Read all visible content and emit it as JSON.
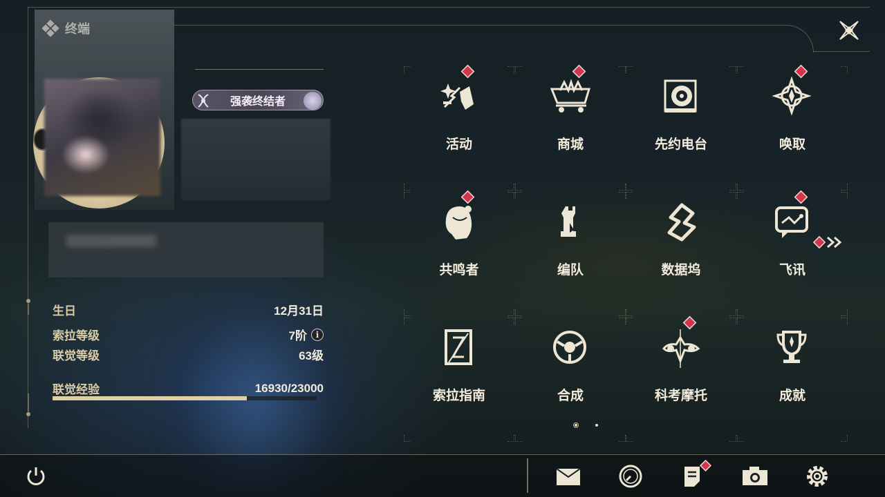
{
  "window": {
    "title": "终端"
  },
  "profile": {
    "title_badge": "强袭终结者",
    "stats": [
      {
        "label": "生日",
        "value": "12月31日"
      },
      {
        "label": "索拉等级",
        "value": "7阶"
      },
      {
        "label": "联觉等级",
        "value": "63级"
      }
    ],
    "exp": {
      "label": "联觉经验",
      "value": "16930/23000",
      "current": 16930,
      "max": 23000
    }
  },
  "menu": {
    "items": [
      {
        "label": "活动",
        "icon": "activity-icon",
        "badge": true
      },
      {
        "label": "商城",
        "icon": "shop-icon",
        "badge": true
      },
      {
        "label": "先约电台",
        "icon": "radio-icon",
        "badge": false
      },
      {
        "label": "唤取",
        "icon": "summon-icon",
        "badge": true
      },
      {
        "label": "共鸣者",
        "icon": "resonator-icon",
        "badge": true
      },
      {
        "label": "编队",
        "icon": "team-icon",
        "badge": false
      },
      {
        "label": "数据坞",
        "icon": "data-bank-icon",
        "badge": false
      },
      {
        "label": "飞讯",
        "icon": "chat-icon",
        "badge": true
      },
      {
        "label": "索拉指南",
        "icon": "guide-icon",
        "badge": false
      },
      {
        "label": "合成",
        "icon": "synthesis-icon",
        "badge": false
      },
      {
        "label": "科考摩托",
        "icon": "motorcycle-icon",
        "badge": true
      },
      {
        "label": "成就",
        "icon": "trophy-icon",
        "badge": false
      }
    ],
    "page": {
      "current": 1,
      "total": 2
    }
  },
  "bottom": {
    "icons": [
      "power-icon",
      "mail-icon",
      "clock-icon",
      "notice-icon",
      "camera-icon",
      "settings-icon"
    ]
  },
  "colors": {
    "accent": "#e0cfa3",
    "badge": "#d1364a",
    "text": "#f4eddd"
  }
}
